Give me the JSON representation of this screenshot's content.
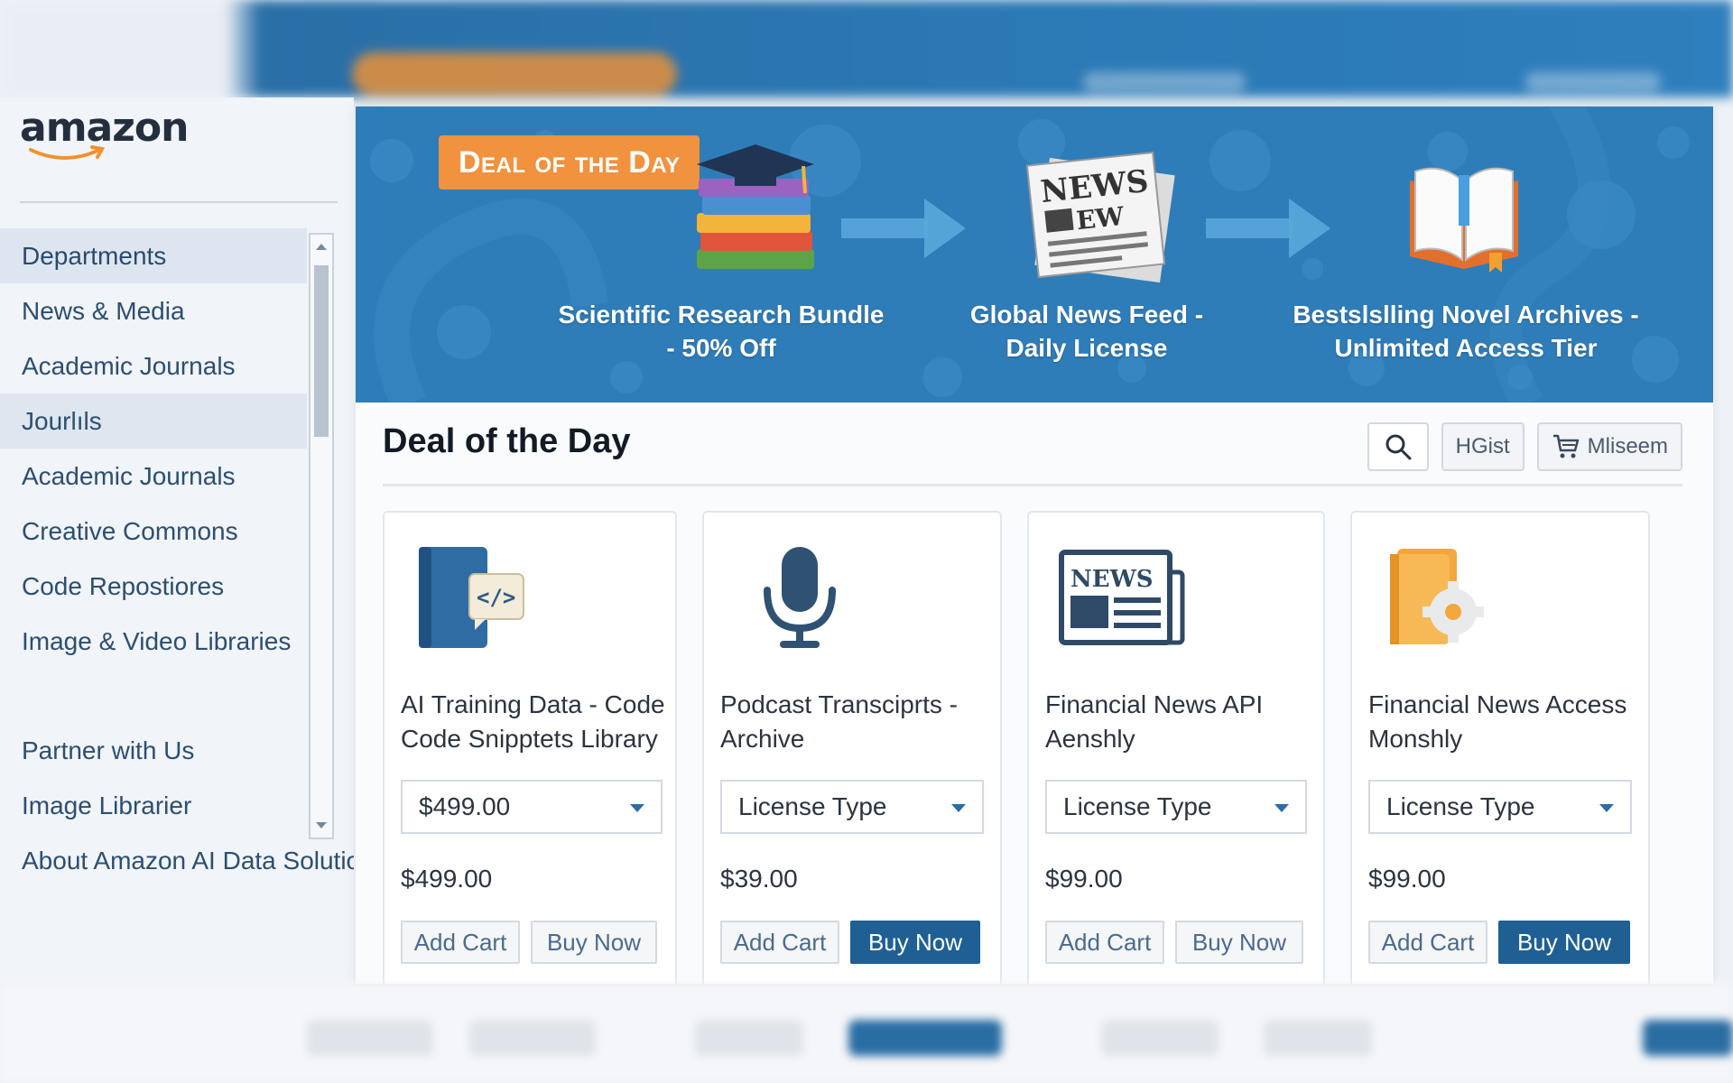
{
  "brand": {
    "logo_text": "amazon"
  },
  "sidebar": {
    "items": [
      {
        "label": "Departments"
      },
      {
        "label": "News & Media"
      },
      {
        "label": "Academic Journals"
      },
      {
        "label": "Jourlıls"
      },
      {
        "label": "Academic Journals"
      },
      {
        "label": "Creative Commons"
      },
      {
        "label": "Code Repostiores"
      },
      {
        "label": "Image & Video Libraries"
      }
    ],
    "footer_items": [
      {
        "label": "Partner with Us"
      },
      {
        "label": "Image Librarier"
      },
      {
        "label": "About Amazon AI Data Solutio"
      }
    ]
  },
  "banner": {
    "tag": "Deal of the Day",
    "items": [
      {
        "line1": "Scientific Research Bundle",
        "line2": "- 50% Off",
        "icon": "books-graduation-cap-icon"
      },
      {
        "line1": "Global News Feed -",
        "line2": "Daily License",
        "icon": "newspaper-icon",
        "icon_text": "NEWS",
        "icon_sub": "EW"
      },
      {
        "line1": "Bestslslling Novel Archives -",
        "line2": "Unlimited Access Tier",
        "icon": "open-book-icon"
      }
    ]
  },
  "section": {
    "title": "Deal of the Day",
    "tools": {
      "filter_label": "HGist",
      "cart_label": "Mliseem"
    }
  },
  "products": [
    {
      "title_line1": "AI Training Data - Code",
      "title_line2": "Code Snipptets Library",
      "select": "$499.00",
      "price": "$499.00",
      "add_label": "Add Cart",
      "buy_label": "Buy Now",
      "buy_primary": false,
      "icon": "code-book-icon"
    },
    {
      "title_line1": "Podcast Transciprts -",
      "title_line2": "Archive",
      "select": "License Type",
      "price": "$39.00",
      "add_label": "Add Cart",
      "buy_label": "Buy Now",
      "buy_primary": true,
      "icon": "microphone-icon"
    },
    {
      "title_line1": "Financial News API",
      "title_line2": "Aenshly",
      "select": "License Type",
      "price": "$99.00",
      "add_label": "Add Cart",
      "buy_label": "Buy Now",
      "buy_primary": false,
      "icon": "newspaper-icon",
      "icon_text": "NEWS"
    },
    {
      "title_line1": "Financial News Access",
      "title_line2": "Monshly",
      "select": "License Type",
      "price": "$99.00",
      "add_label": "Add Cart",
      "buy_label": "Buy Now",
      "buy_primary": true,
      "icon": "book-gear-icon"
    }
  ],
  "colors": {
    "banner": "#2f7db8",
    "accent_orange": "#f0923e",
    "primary_button": "#1f5f93"
  }
}
